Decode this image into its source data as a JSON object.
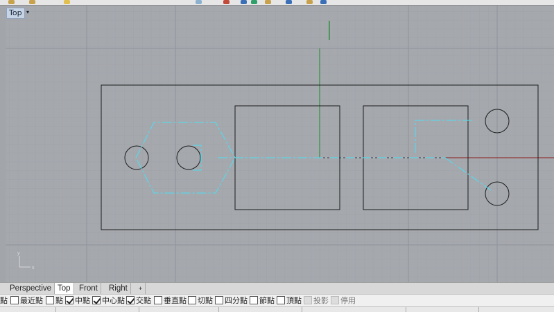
{
  "viewport": {
    "label": "Top"
  },
  "view_tabs": [
    {
      "label": "Perspective",
      "active": false
    },
    {
      "label": "Top",
      "active": true
    },
    {
      "label": "Front",
      "active": false
    },
    {
      "label": "Right",
      "active": false
    },
    {
      "label": "+",
      "active": false
    }
  ],
  "axis_icon": {
    "y": "y",
    "x": "x"
  },
  "osnaps": [
    {
      "label": "點",
      "checked": false,
      "enabled": true
    },
    {
      "label": "最近點",
      "checked": false,
      "enabled": true
    },
    {
      "label": "點",
      "checked": true,
      "enabled": true
    },
    {
      "label": "中點",
      "checked": true,
      "enabled": true
    },
    {
      "label": "中心點",
      "checked": true,
      "enabled": true
    },
    {
      "label": "交點",
      "checked": false,
      "enabled": true
    },
    {
      "label": "垂直點",
      "checked": false,
      "enabled": true
    },
    {
      "label": "切點",
      "checked": false,
      "enabled": true
    },
    {
      "label": "四分點",
      "checked": false,
      "enabled": true
    },
    {
      "label": "節點",
      "checked": false,
      "enabled": true
    },
    {
      "label": "頂點",
      "checked": false,
      "enabled": false
    },
    {
      "label": "投影",
      "checked": false,
      "enabled": false
    },
    {
      "label": "停用",
      "checked": false,
      "enabled": false
    }
  ],
  "colors": {
    "grid_minor": "#9ca0a6",
    "grid_major": "#8f949a",
    "x_axis": "#8c1c1c",
    "y_axis": "#1a8a2a",
    "geometry": "#1b1b1b",
    "centerline": "#5fd4e6",
    "viewport_bg": "#a5a8ad"
  }
}
